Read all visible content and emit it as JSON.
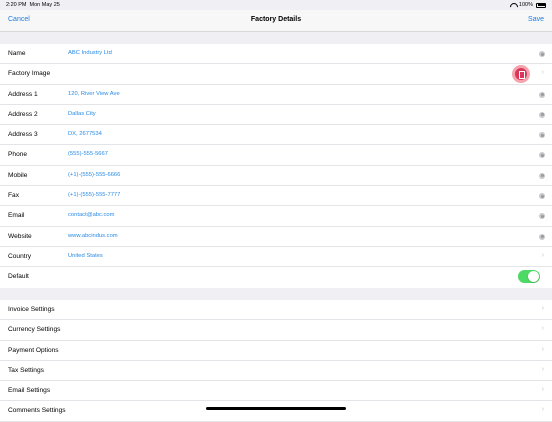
{
  "status": {
    "time": "2:20 PM",
    "date": "Mon May 25",
    "battery": "100%"
  },
  "nav": {
    "cancel": "Cancel",
    "title": "Factory Details",
    "save": "Save"
  },
  "fields": [
    {
      "label": "Name",
      "value": "ABC Industry Ltd",
      "accessory": "clear-icon"
    },
    {
      "label": "Factory Image",
      "value": "",
      "accessory": "chevron"
    },
    {
      "label": "Address 1",
      "value": "120, River View Ave",
      "accessory": "clear-icon"
    },
    {
      "label": "Address 2",
      "value": "Dallas City",
      "accessory": "clear-icon"
    },
    {
      "label": "Address 3",
      "value": "DX, 2677534",
      "accessory": "clear-icon"
    },
    {
      "label": "Phone",
      "value": "(555)-555-5667",
      "accessory": "clear-icon"
    },
    {
      "label": "Mobile",
      "value": "(+1)-(555)-555-6666",
      "accessory": "clear-icon"
    },
    {
      "label": "Fax",
      "value": "(+1)-(555)-555-7777",
      "accessory": "clear-icon"
    },
    {
      "label": "Email",
      "value": "contact@abc.com",
      "accessory": "clear-icon"
    },
    {
      "label": "Website",
      "value": "www.abcindus.com",
      "accessory": "clear-icon"
    },
    {
      "label": "Country",
      "value": "United States",
      "accessory": "chevron"
    },
    {
      "label": "Default",
      "value": "",
      "toggle_on": true
    }
  ],
  "settings": [
    {
      "label": "Invoice Settings"
    },
    {
      "label": "Currency Settings"
    },
    {
      "label": "Payment Options"
    },
    {
      "label": "Tax Settings"
    },
    {
      "label": "Email Settings"
    },
    {
      "label": "Comments Settings"
    }
  ],
  "chevron_glyph": "›",
  "colors": {
    "accent": "#1e7ce0",
    "value_text": "#2a8be6",
    "toggle_on": "#4cd964",
    "image_button": "#d9385a"
  }
}
